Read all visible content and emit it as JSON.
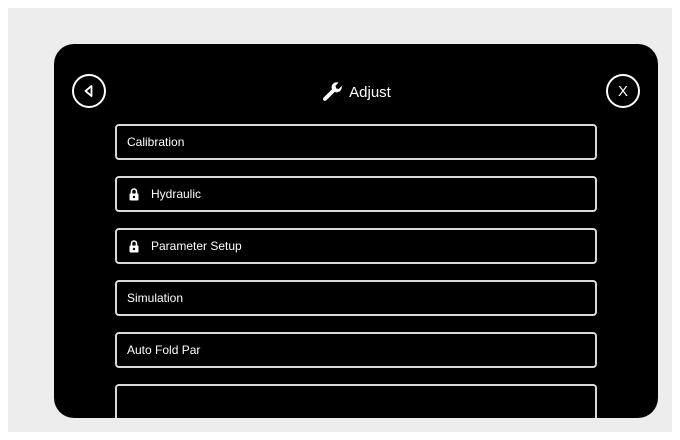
{
  "header": {
    "title": "Adjust",
    "back_icon": "back-arrow-icon",
    "title_icon": "wrench-icon",
    "close_label": "X"
  },
  "menu": {
    "items": [
      {
        "label": "Calibration",
        "locked": false
      },
      {
        "label": "Hydraulic",
        "locked": true
      },
      {
        "label": "Parameter Setup",
        "locked": true
      },
      {
        "label": "Simulation",
        "locked": false
      },
      {
        "label": "Auto Fold Par",
        "locked": false
      },
      {
        "label": "",
        "locked": false
      }
    ]
  },
  "colors": {
    "background": "#ededed",
    "panel": "#000000",
    "text": "#ffffff",
    "border": "#d9d9d9"
  }
}
